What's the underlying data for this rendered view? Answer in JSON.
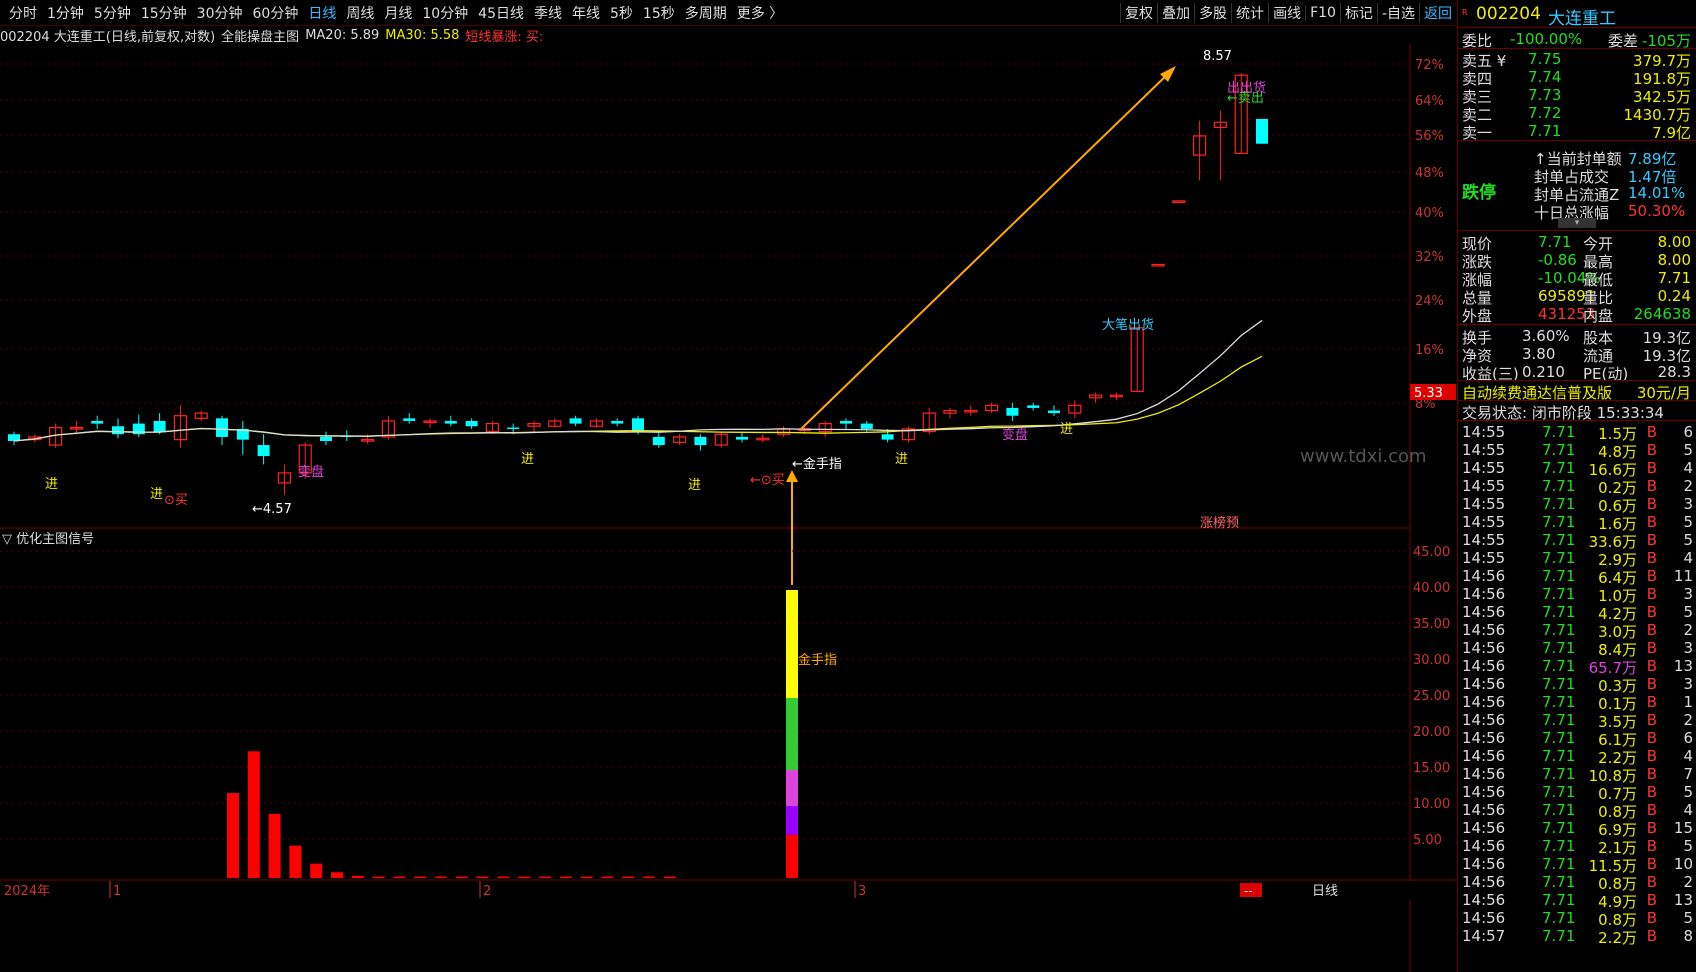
{
  "toolbar": {
    "periods": [
      "分时",
      "1分钟",
      "5分钟",
      "15分钟",
      "30分钟",
      "60分钟",
      "日线",
      "周线",
      "月线",
      "10分钟",
      "45日线",
      "季线",
      "年线",
      "5秒",
      "15秒",
      "多周期",
      "更多 〉"
    ],
    "active_period": "日线",
    "tools": [
      "复权",
      "叠加",
      "多股",
      "统计",
      "画线",
      "F10",
      "标记",
      "-自选",
      "返回"
    ]
  },
  "info": {
    "title": "002204 大连重工(日线,前复权,对数)",
    "indicator": "全能操盘主图",
    "ma20": "MA20: 5.89",
    "ma30": "MA30: 5.58",
    "extra": "短线暴涨: 买:"
  },
  "price_axis": [
    "72%",
    "64%",
    "56%",
    "48%",
    "40%",
    "32%",
    "24%",
    "16%",
    "8%"
  ],
  "price_marker": "5.33",
  "high_label": "8.57",
  "low_label": "←4.57",
  "sub_title": "优化主图信号",
  "sub_axis": [
    "45.00",
    "40.00",
    "35.00",
    "30.00",
    "25.00",
    "20.00",
    "15.00",
    "10.00",
    "5.00"
  ],
  "bottom_axis": {
    "year": "2024年",
    "months": [
      "1",
      "2",
      "3"
    ],
    "period": "日线",
    "badge": "--"
  },
  "signals": {
    "jin": "进",
    "buy": "⊙买",
    "buy2": "←⊙买",
    "biandan": "变盘",
    "golden": "←金手指",
    "golden2": "金手指",
    "dabi": "大笔出货",
    "chuhuo": "出出货",
    "maichu": "←卖出",
    "zhangting": "涨榜预"
  },
  "watermark": "www.tdxi.com",
  "panel": {
    "code": "002204",
    "name": "大连重工",
    "weibi_label": "委比",
    "weibi": "-100.00%",
    "weicha_label": "委差",
    "weicha": "-105万",
    "asks": [
      {
        "label": "卖五 ¥",
        "price": "7.75",
        "vol": "379.7万"
      },
      {
        "label": "卖四",
        "price": "7.74",
        "vol": "191.8万"
      },
      {
        "label": "卖三",
        "price": "7.73",
        "vol": "342.5万"
      },
      {
        "label": "卖二",
        "price": "7.72",
        "vol": "1430.7万"
      },
      {
        "label": "卖一",
        "price": "7.71",
        "vol": "7.9亿"
      }
    ],
    "limit_label": "跌停",
    "seal": [
      {
        "label": "↑当前封单额",
        "value": "7.89亿"
      },
      {
        "label": "封单占成交",
        "value": "1.47倍"
      },
      {
        "label": "封单占流通Z",
        "value": "14.01%"
      },
      {
        "label": "十日总涨幅",
        "value": "50.30%"
      }
    ],
    "quote": [
      {
        "l1": "现价",
        "v1": "7.71",
        "l2": "今开",
        "v2": "8.00"
      },
      {
        "l1": "涨跌",
        "v1": "-0.86",
        "l2": "最高",
        "v2": "8.00"
      },
      {
        "l1": "涨幅",
        "v1": "-10.04%",
        "l2": "最低",
        "v2": "7.71"
      },
      {
        "l1": "总量",
        "v1": "695891",
        "l2": "量比",
        "v2": "0.24"
      },
      {
        "l1": "外盘",
        "v1": "431253",
        "l2": "内盘",
        "v2": "264638"
      }
    ],
    "stats": [
      {
        "l1": "换手",
        "v1": "3.60%",
        "l2": "股本",
        "v2": "19.3亿"
      },
      {
        "l1": "净资",
        "v1": "3.80",
        "l2": "流通",
        "v2": "19.3亿"
      },
      {
        "l1": "收益(三)",
        "v1": "0.210",
        "l2": "PE(动)",
        "v2": "28.3"
      }
    ],
    "promo": "自动续费通达信普及版",
    "promo_price": "30元/月",
    "status": "交易状态: 闭市阶段 15:33:34",
    "ticks": [
      {
        "t": "14:55",
        "p": "7.71",
        "v": "1.5万",
        "n": "6"
      },
      {
        "t": "14:55",
        "p": "7.71",
        "v": "4.8万",
        "n": "5"
      },
      {
        "t": "14:55",
        "p": "7.71",
        "v": "16.6万",
        "n": "4"
      },
      {
        "t": "14:55",
        "p": "7.71",
        "v": "0.2万",
        "n": "2"
      },
      {
        "t": "14:55",
        "p": "7.71",
        "v": "0.6万",
        "n": "3"
      },
      {
        "t": "14:55",
        "p": "7.71",
        "v": "1.6万",
        "n": "5"
      },
      {
        "t": "14:55",
        "p": "7.71",
        "v": "33.6万",
        "n": "5"
      },
      {
        "t": "14:55",
        "p": "7.71",
        "v": "2.9万",
        "n": "4"
      },
      {
        "t": "14:56",
        "p": "7.71",
        "v": "6.4万",
        "n": "11"
      },
      {
        "t": "14:56",
        "p": "7.71",
        "v": "1.0万",
        "n": "3"
      },
      {
        "t": "14:56",
        "p": "7.71",
        "v": "4.2万",
        "n": "5"
      },
      {
        "t": "14:56",
        "p": "7.71",
        "v": "3.0万",
        "n": "2"
      },
      {
        "t": "14:56",
        "p": "7.71",
        "v": "8.4万",
        "n": "3"
      },
      {
        "t": "14:56",
        "p": "7.71",
        "v": "65.7万",
        "n": "13"
      },
      {
        "t": "14:56",
        "p": "7.71",
        "v": "0.3万",
        "n": "3"
      },
      {
        "t": "14:56",
        "p": "7.71",
        "v": "0.1万",
        "n": "1"
      },
      {
        "t": "14:56",
        "p": "7.71",
        "v": "3.5万",
        "n": "2"
      },
      {
        "t": "14:56",
        "p": "7.71",
        "v": "6.1万",
        "n": "6"
      },
      {
        "t": "14:56",
        "p": "7.71",
        "v": "2.2万",
        "n": "4"
      },
      {
        "t": "14:56",
        "p": "7.71",
        "v": "10.8万",
        "n": "7"
      },
      {
        "t": "14:56",
        "p": "7.71",
        "v": "0.7万",
        "n": "5"
      },
      {
        "t": "14:56",
        "p": "7.71",
        "v": "0.8万",
        "n": "4"
      },
      {
        "t": "14:56",
        "p": "7.71",
        "v": "6.9万",
        "n": "15"
      },
      {
        "t": "14:56",
        "p": "7.71",
        "v": "2.1万",
        "n": "5"
      },
      {
        "t": "14:56",
        "p": "7.71",
        "v": "11.5万",
        "n": "10"
      },
      {
        "t": "14:56",
        "p": "7.71",
        "v": "0.8万",
        "n": "2"
      },
      {
        "t": "14:56",
        "p": "7.71",
        "v": "4.9万",
        "n": "13"
      },
      {
        "t": "14:56",
        "p": "7.71",
        "v": "0.8万",
        "n": "5"
      },
      {
        "t": "14:57",
        "p": "7.71",
        "v": "2.2万",
        "n": "8"
      }
    ],
    "tick_flag": "B"
  },
  "chart_data": {
    "type": "candlestick",
    "candles": [
      {
        "o": 5.0,
        "c": 4.95,
        "h": 5.02,
        "l": 4.92
      },
      {
        "o": 4.96,
        "c": 4.98,
        "h": 5.0,
        "l": 4.94
      },
      {
        "o": 4.92,
        "c": 5.05,
        "h": 5.08,
        "l": 4.9
      },
      {
        "o": 5.05,
        "c": 5.05,
        "h": 5.1,
        "l": 5.0
      },
      {
        "o": 5.1,
        "c": 5.08,
        "h": 5.14,
        "l": 5.04
      },
      {
        "o": 5.06,
        "c": 5.0,
        "h": 5.12,
        "l": 4.97
      },
      {
        "o": 5.08,
        "c": 5.0,
        "h": 5.15,
        "l": 4.98
      },
      {
        "o": 5.1,
        "c": 5.02,
        "h": 5.16,
        "l": 5.0
      },
      {
        "o": 4.96,
        "c": 5.14,
        "h": 5.22,
        "l": 4.9
      },
      {
        "o": 5.12,
        "c": 5.16,
        "h": 5.18,
        "l": 5.1
      },
      {
        "o": 5.12,
        "c": 4.98,
        "h": 5.14,
        "l": 4.92
      },
      {
        "o": 5.04,
        "c": 4.96,
        "h": 5.1,
        "l": 4.85
      },
      {
        "o": 4.92,
        "c": 4.84,
        "h": 5.0,
        "l": 4.78
      },
      {
        "o": 4.65,
        "c": 4.72,
        "h": 4.78,
        "l": 4.57
      },
      {
        "o": 4.72,
        "c": 4.92,
        "h": 4.94,
        "l": 4.68
      },
      {
        "o": 4.98,
        "c": 4.95,
        "h": 5.02,
        "l": 4.92
      },
      {
        "o": 4.99,
        "c": 4.98,
        "h": 5.03,
        "l": 4.95
      },
      {
        "o": 4.95,
        "c": 4.96,
        "h": 5.0,
        "l": 4.93
      },
      {
        "o": 4.98,
        "c": 5.1,
        "h": 5.14,
        "l": 4.96
      },
      {
        "o": 5.12,
        "c": 5.1,
        "h": 5.16,
        "l": 5.08
      },
      {
        "o": 5.1,
        "c": 5.1,
        "h": 5.12,
        "l": 5.05
      },
      {
        "o": 5.1,
        "c": 5.08,
        "h": 5.14,
        "l": 5.06
      },
      {
        "o": 5.1,
        "c": 5.06,
        "h": 5.12,
        "l": 5.04
      },
      {
        "o": 5.02,
        "c": 5.08,
        "h": 5.1,
        "l": 5.0
      },
      {
        "o": 5.05,
        "c": 5.04,
        "h": 5.08,
        "l": 5.0
      },
      {
        "o": 5.06,
        "c": 5.08,
        "h": 5.1,
        "l": 5.02
      },
      {
        "o": 5.06,
        "c": 5.1,
        "h": 5.12,
        "l": 5.05
      },
      {
        "o": 5.12,
        "c": 5.08,
        "h": 5.14,
        "l": 5.06
      },
      {
        "o": 5.06,
        "c": 5.1,
        "h": 5.12,
        "l": 5.05
      },
      {
        "o": 5.1,
        "c": 5.08,
        "h": 5.12,
        "l": 5.06
      },
      {
        "o": 5.12,
        "c": 5.02,
        "h": 5.14,
        "l": 5.0
      },
      {
        "o": 4.98,
        "c": 4.92,
        "h": 5.02,
        "l": 4.9
      },
      {
        "o": 4.94,
        "c": 4.98,
        "h": 5.0,
        "l": 4.92
      },
      {
        "o": 4.98,
        "c": 4.92,
        "h": 5.0,
        "l": 4.88
      },
      {
        "o": 4.92,
        "c": 5.0,
        "h": 5.02,
        "l": 4.9
      },
      {
        "o": 4.98,
        "c": 4.96,
        "h": 5.02,
        "l": 4.94
      },
      {
        "o": 4.96,
        "c": 4.97,
        "h": 5.0,
        "l": 4.94
      },
      {
        "o": 5.0,
        "c": 5.04,
        "h": 5.06,
        "l": 4.98
      },
      {
        "o": 5.04,
        "c": 5.04,
        "h": 5.07,
        "l": 5.0
      },
      {
        "o": 5.02,
        "c": 5.08,
        "h": 5.1,
        "l": 4.98
      },
      {
        "o": 5.1,
        "c": 5.08,
        "h": 5.12,
        "l": 5.04
      },
      {
        "o": 5.08,
        "c": 5.04,
        "h": 5.1,
        "l": 5.02
      },
      {
        "o": 5.0,
        "c": 4.96,
        "h": 5.04,
        "l": 4.94
      },
      {
        "o": 4.96,
        "c": 5.04,
        "h": 5.06,
        "l": 4.94
      },
      {
        "o": 5.02,
        "c": 5.16,
        "h": 5.2,
        "l": 5.0
      },
      {
        "o": 5.16,
        "c": 5.18,
        "h": 5.2,
        "l": 5.12
      },
      {
        "o": 5.18,
        "c": 5.18,
        "h": 5.22,
        "l": 5.14
      },
      {
        "o": 5.18,
        "c": 5.22,
        "h": 5.24,
        "l": 5.16
      },
      {
        "o": 5.2,
        "c": 5.14,
        "h": 5.24,
        "l": 5.1
      },
      {
        "o": 5.22,
        "c": 5.2,
        "h": 5.24,
        "l": 5.18
      },
      {
        "o": 5.18,
        "c": 5.16,
        "h": 5.22,
        "l": 5.14
      },
      {
        "o": 5.16,
        "c": 5.22,
        "h": 5.26,
        "l": 5.12
      },
      {
        "o": 5.28,
        "c": 5.3,
        "h": 5.32,
        "l": 5.24
      },
      {
        "o": 5.3,
        "c": 5.3,
        "h": 5.32,
        "l": 5.26
      },
      {
        "o": 5.33,
        "c": 5.86,
        "h": 5.86,
        "l": 5.33
      },
      {
        "o": 6.44,
        "c": 6.44,
        "h": 6.44,
        "l": 6.44
      },
      {
        "o": 7.08,
        "c": 7.08,
        "h": 7.08,
        "l": 7.08
      },
      {
        "o": 7.58,
        "c": 7.8,
        "h": 7.98,
        "l": 7.3
      },
      {
        "o": 7.9,
        "c": 7.96,
        "h": 8.1,
        "l": 7.3
      },
      {
        "o": 7.6,
        "c": 8.54,
        "h": 8.57,
        "l": 7.6
      },
      {
        "o": 8.0,
        "c": 7.71,
        "h": 8.0,
        "l": 7.71
      }
    ],
    "ma20_label": "MA20",
    "ma30_label": "MA30",
    "sub_bars": [
      11.8,
      17.6,
      8.9,
      4.5,
      2.0,
      0.8,
      0.3,
      0.2,
      0.2,
      0.2,
      0.2,
      0.2,
      0.2,
      0.2,
      0.2,
      0.2,
      0.2,
      0.2,
      0.2,
      0.2,
      0.2,
      0.2
    ],
    "golden_bar": 40.0
  }
}
